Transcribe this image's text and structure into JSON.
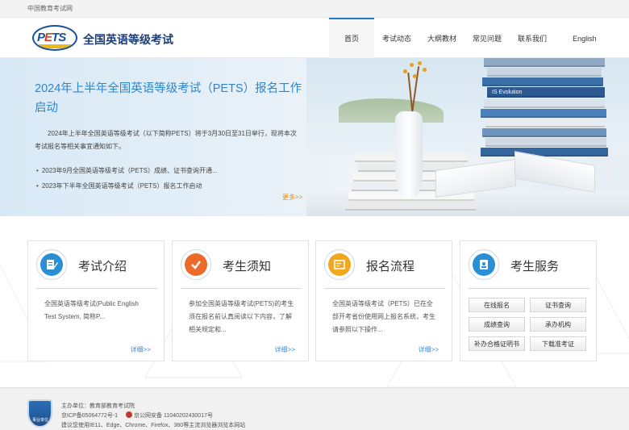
{
  "topbar": {
    "text": "中国教育考试网"
  },
  "header": {
    "logo_text": "PETS",
    "site_title": "全国英语等级考试",
    "nav": [
      {
        "label": "首页",
        "active": true
      },
      {
        "label": "考试动态"
      },
      {
        "label": "大纲教材"
      },
      {
        "label": "常见问题"
      },
      {
        "label": "联系我们"
      },
      {
        "label": "English"
      }
    ]
  },
  "banner": {
    "title": "2024年上半年全国英语等级考试（PETS）报名工作启动",
    "description": "2024年上半年全国英语等级考试（以下简称PETS）将于3月30日至31日举行，现将本次考试报名等相关事宜通知如下。",
    "news": [
      "2023年9月全国英语等级考试（PETS）成绩、证书查询开通...",
      "2023年下半年全国英语等级考试（PETS）报名工作启动"
    ],
    "more": "更多>>",
    "book_spines": [
      "IS Evolution"
    ]
  },
  "cards": [
    {
      "icon": "document-pen-icon",
      "color": "#2b8fd6",
      "title": "考试介绍",
      "desc": "全国英语等级考试(Public English Test System, 简称P...",
      "more": "详细>>"
    },
    {
      "icon": "checkmark-icon",
      "color": "#ec6a2a",
      "title": "考生须知",
      "desc": "参加全国英语等级考试(PETS)的考生须在报名前认真阅读以下内容，了解相关规定和...",
      "more": "详细>>"
    },
    {
      "icon": "registration-form-icon",
      "color": "#f0a81e",
      "title": "报名流程",
      "desc": "全国英语等级考试（PETS）已在全部开考省份使用网上报名系统，考生请参照以下操作...",
      "more": "详细>>"
    },
    {
      "icon": "id-card-icon",
      "color": "#2b8fd6",
      "title": "考生服务",
      "services": [
        "在线报名",
        "证书查询",
        "成绩查询",
        "承办机构",
        "补办合格证明书",
        "下载准考证"
      ]
    }
  ],
  "footer": {
    "badge_text": "事业单位",
    "sponsor": "主办单位：教育部教育考试院",
    "icp": "京ICP备05064772号-1",
    "police": "京公网安备 11040202430017号",
    "browser_note": "建议您使用IE11、Edge、Chrome、Firefox、360等主流浏览器浏览本网站"
  }
}
